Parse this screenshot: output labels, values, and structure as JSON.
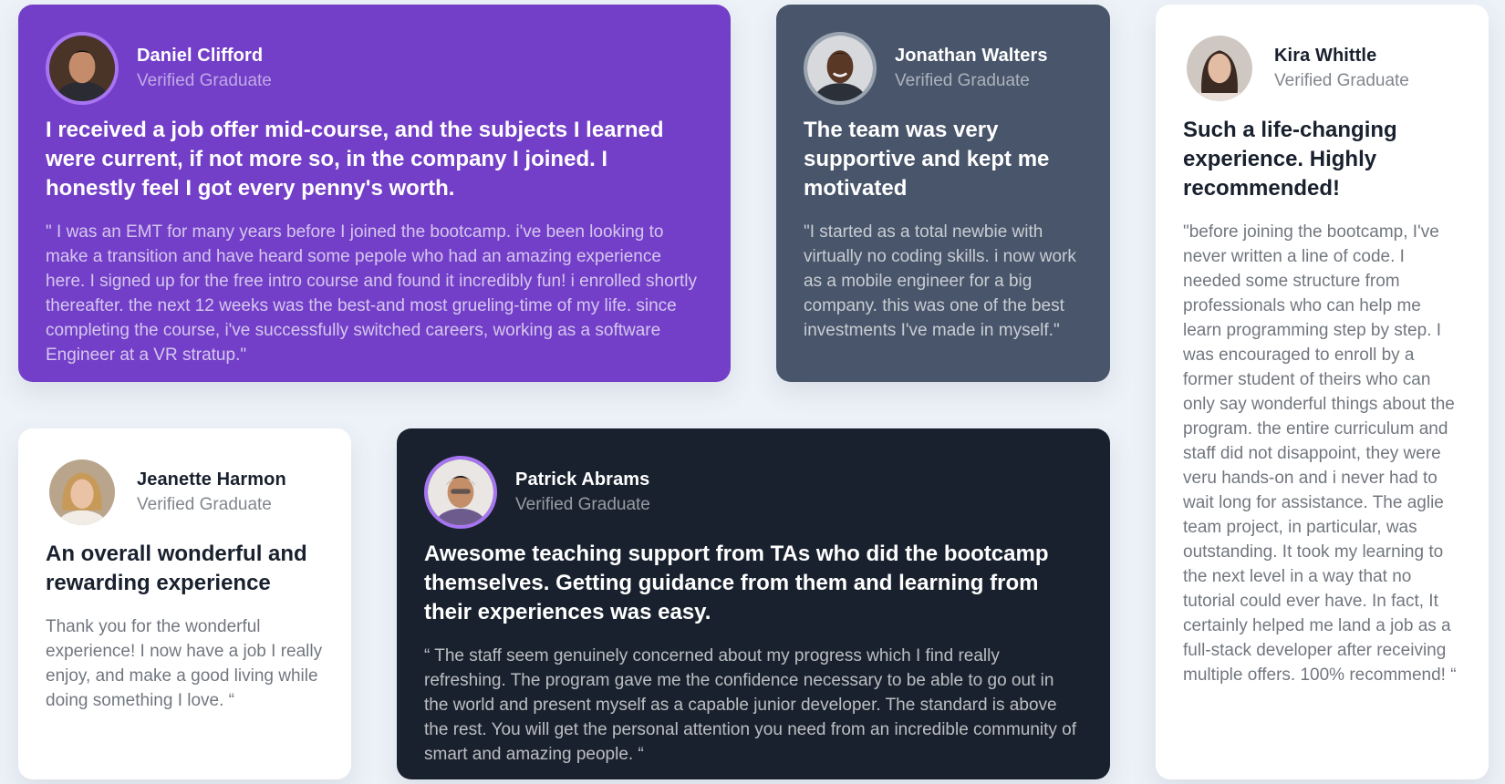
{
  "testimonials": [
    {
      "name": "Daniel Clifford",
      "role": "Verified Graduate",
      "headline": "I received a job offer mid-course, and the subjects I learned were current, if not more so, in the company I joined. I honestly feel I got every penny's worth.",
      "quote": "\" I was an EMT for many years before I joined the bootcamp. i've been looking to make a transition and have heard some pepole who had an amazing experience here. I signed up for the free intro course and found it incredibly fun! i enrolled shortly thereafter. the next 12 weeks was the best-and most grueling-time of my life. since completing the course, i've successfully switched careers, working as a software Engineer at a VR stratup.\""
    },
    {
      "name": "Jonathan Walters",
      "role": "Verified Graduate",
      "headline": "The team was very supportive and kept me motivated",
      "quote": "\"I started as a total newbie with virtually no coding skills. i now work as a mobile engineer for a big company. this was one of the best investments I've made in myself.\""
    },
    {
      "name": "Kira Whittle",
      "role": "Verified Graduate",
      "headline": "Such a life-changing experience. Highly recommended!",
      "quote": "\"before joining the bootcamp, I've never written a line of code. I needed some structure from professionals who can help me learn programming step by step. I was encouraged to enroll by a former student of theirs who can only say wonderful things about the program. the entire curriculum and staff did not disappoint, they were veru hands-on and i never had to wait long for assistance. The aglie team project, in particular, was outstanding. It took my learning to the next level in a way that no tutorial could ever have. In fact, It certainly helped me land a job as a full-stack developer after receiving multiple offers. 100% recommend! “"
    },
    {
      "name": "Jeanette Harmon",
      "role": "Verified Graduate",
      "headline": "An overall wonderful and rewarding experience",
      "quote": "Thank you for the wonderful experience! I now have a job I really enjoy, and make a good living while doing something I love. “"
    },
    {
      "name": "Patrick Abrams",
      "role": "Verified Graduate",
      "headline": "Awesome teaching support from TAs who did the bootcamp themselves. Getting guidance from them and learning from their experiences was easy.",
      "quote": "“ The staff seem genuinely concerned about my progress which I find really refreshing. The program gave me the confidence necessary to be able to go out in the world and present myself as a capable junior developer. The standard is above the rest. You will get the personal attention you need from an incredible community of smart and amazing people. “"
    }
  ],
  "colors": {
    "background": "#edf2f8",
    "purple": "#733fc8",
    "slate": "#48556a",
    "dark": "#19212e",
    "white": "#ffffff"
  }
}
